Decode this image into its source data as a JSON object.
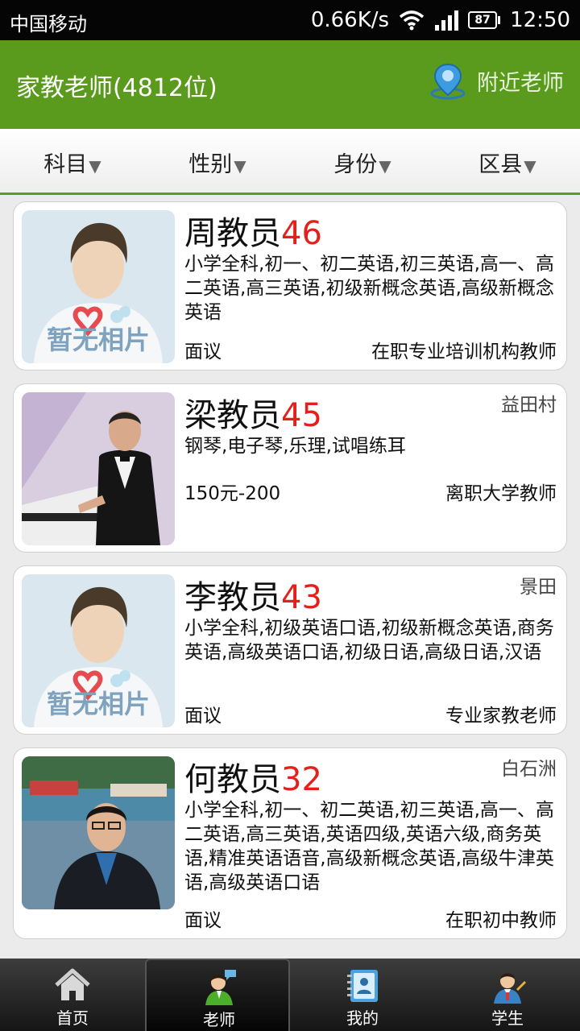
{
  "status_bar": {
    "carrier": "中国移动",
    "speed": "0.66K/s",
    "battery": "87",
    "time": "12:50"
  },
  "header": {
    "title": "家教老师(4812位)",
    "nearby_label": "附近老师",
    "icon": "location-pin-icon"
  },
  "filters": [
    {
      "label": "科目"
    },
    {
      "label": "性别"
    },
    {
      "label": "身份"
    },
    {
      "label": "区县"
    }
  ],
  "filter_arrow": "▼",
  "teachers": [
    {
      "name": "周教员",
      "age": "46",
      "location": "",
      "subjects": "小学全科,初一、初二英语,初三英语,高一、高二英语,高三英语,初级新概念英语,高级新概念英语",
      "price": "面议",
      "role": "在职专业培训机构教师",
      "photo": "placeholder-no-photo"
    },
    {
      "name": "梁教员",
      "age": "45",
      "location": "益田村",
      "subjects": "钢琴,电子琴,乐理,试唱练耳",
      "price": "150元-200",
      "role": "离职大学教师",
      "photo": "man-at-piano"
    },
    {
      "name": "李教员",
      "age": "43",
      "location": "景田",
      "subjects": "小学全科,初级英语口语,初级新概念英语,商务英语,高级英语口语,初级日语,高级日语,汉语",
      "price": "面议",
      "role": "专业家教老师",
      "photo": "placeholder-no-photo"
    },
    {
      "name": "何教员",
      "age": "32",
      "location": "白石洲",
      "subjects": "小学全科,初一、初二英语,初三英语,高一、高二英语,高三英语,英语四级,英语六级,商务英语,精准英语语音,高级新概念英语,高级牛津英语,高级英语口语",
      "price": "面议",
      "role": "在职初中教师",
      "photo": "man-by-lake"
    }
  ],
  "placeholder_photo_text": "暂无相片",
  "bottom_nav": [
    {
      "label": "首页",
      "icon": "home-icon",
      "active": false
    },
    {
      "label": "老师",
      "icon": "teacher-icon",
      "active": true
    },
    {
      "label": "我的",
      "icon": "contact-card-icon",
      "active": false
    },
    {
      "label": "学生",
      "icon": "student-icon",
      "active": false
    }
  ],
  "colors": {
    "brand_green": "#5a9b1d",
    "age_red": "#e3201b",
    "status_bar": "#050505"
  }
}
